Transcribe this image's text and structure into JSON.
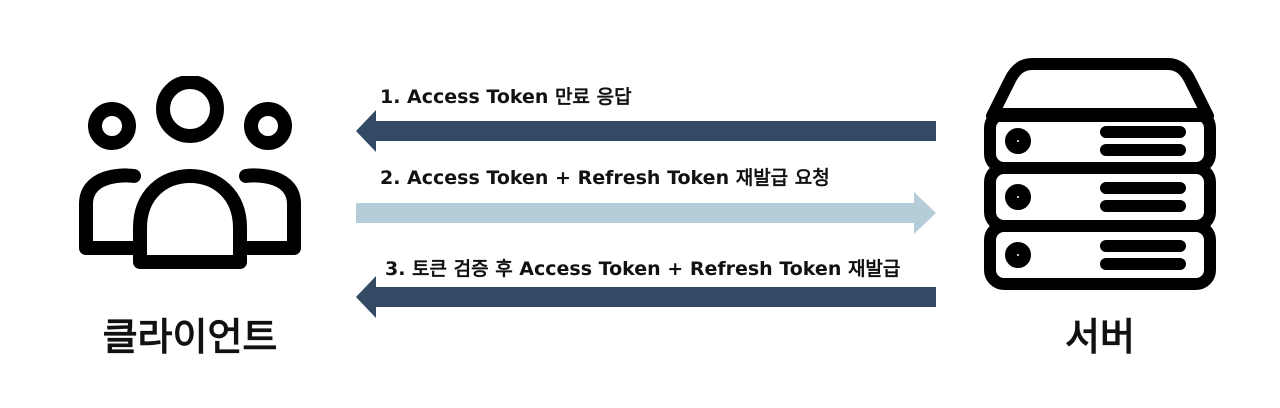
{
  "diagram": {
    "client": {
      "label": "클라이언트",
      "icon": "users-icon"
    },
    "server": {
      "label": "서버",
      "icon": "server-rack-icon"
    },
    "steps": [
      {
        "label": "1. Access Token 만료 응답",
        "direction": "server-to-client",
        "color": "#324a63"
      },
      {
        "label": "2. Access Token + Refresh Token 재발급 요청",
        "direction": "client-to-server",
        "color": "#b5cdd8"
      },
      {
        "label": "3. 토큰 검증 후 Access Token + Refresh Token 재발급",
        "direction": "server-to-client",
        "color": "#324a63"
      }
    ]
  }
}
